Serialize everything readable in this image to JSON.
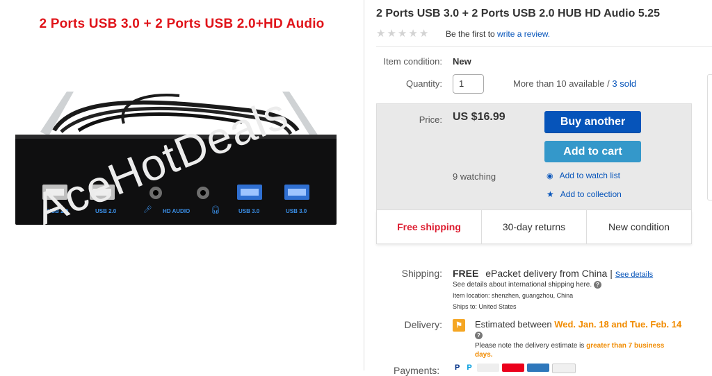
{
  "image_panel": {
    "banner": "2 Ports USB 3.0 + 2 Ports USB 2.0+HD Audio",
    "watermark": "AceHotDeals",
    "port_labels": [
      "USB 2.0",
      "USB 2.0",
      "HD AUDIO",
      "USB 3.0",
      "USB 3.0"
    ]
  },
  "listing": {
    "title": "2 Ports USB 3.0 + 2 Ports USB 2.0 HUB HD Audio 5.25",
    "review_prefix": "Be the first to",
    "review_link": "write a review.",
    "rating_stars": 0
  },
  "details": {
    "condition_label": "Item condition:",
    "condition_value": "New",
    "quantity_label": "Quantity:",
    "quantity_value": "1",
    "availability": "More than 10 available /",
    "sold_link": "3 sold",
    "price_label": "Price:",
    "price_value": "US $16.99",
    "buy_button": "Buy another",
    "cart_button": "Add to cart",
    "watching": "9 watching",
    "watch_link": "Add to watch list",
    "collection_link": "Add to collection"
  },
  "features": [
    "Free shipping",
    "30-day returns",
    "New condition"
  ],
  "shipping": {
    "label": "Shipping:",
    "value": "FREE",
    "method": "ePacket delivery from China |",
    "details_link": "See details",
    "intl_note": "See details about international shipping here.",
    "location": "Item location:  shenzhen, guangzhou, China",
    "ships_to": "Ships to:  United States"
  },
  "delivery": {
    "label": "Delivery:",
    "prefix": "Estimated between",
    "dates": "Wed. Jan. 18 and Tue. Feb. 14",
    "note_prefix": "Please note the delivery estimate is",
    "note_highlight": "greater than 7 business days."
  },
  "payments": {
    "label": "Payments:"
  },
  "colors": {
    "brand_blue": "#0654ba",
    "cart_blue": "#3498ca",
    "red": "#dd1e31",
    "orange": "#f18b00"
  }
}
